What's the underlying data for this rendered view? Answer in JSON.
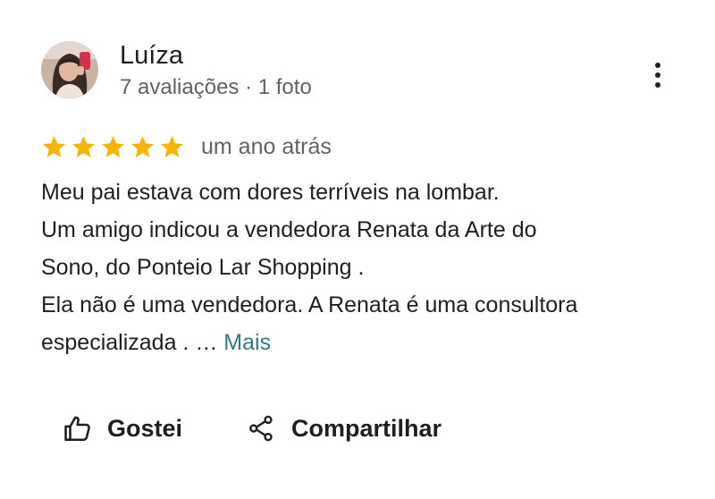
{
  "review": {
    "reviewer_name": "Luíza",
    "reviewer_meta": "7 avaliações · 1 foto",
    "rating": 5,
    "rating_max": 5,
    "date": "um ano atrás",
    "text_lines": [
      "Meu pai estava com dores terríveis na lombar.",
      "Um amigo indicou a vendedora Renata da Arte do",
      "Sono, do Ponteio Lar Shopping .",
      "Ela não é uma vendedora. A Renata é uma consultora"
    ],
    "text_last_line": "especializada . … ",
    "more_label": "Mais"
  },
  "actions": {
    "like_label": "Gostei",
    "share_label": "Compartilhar"
  },
  "colors": {
    "star": "#F4B400",
    "link": "#2B7B8C",
    "secondary_text": "#5F6368",
    "primary_text": "#1F1F1F"
  },
  "icons": {
    "menu": "more-vert-icon",
    "like": "thumb-up-outline-icon",
    "share": "share-icon",
    "star": "star-icon"
  }
}
